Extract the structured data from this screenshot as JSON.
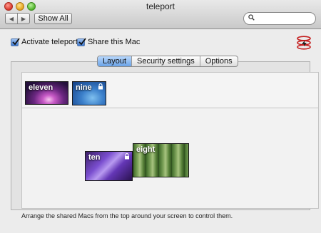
{
  "window": {
    "title": "teleport"
  },
  "toolbar": {
    "back_glyph": "◀",
    "forward_glyph": "▶",
    "show_all_label": "Show All",
    "search_placeholder": ""
  },
  "options": {
    "activate_label": "Activate teleport",
    "activate_checked": true,
    "share_label": "Share this Mac",
    "share_checked": true
  },
  "tabs": [
    {
      "label": "Layout",
      "selected": true
    },
    {
      "label": "Security settings",
      "selected": false
    },
    {
      "label": "Options",
      "selected": false
    }
  ],
  "shelf_macs": [
    {
      "name": "eleven",
      "locked": false
    },
    {
      "name": "nine",
      "locked": true
    }
  ],
  "layout_macs": [
    {
      "name": "ten",
      "locked": true
    },
    {
      "name": "eight",
      "locked": false
    }
  ],
  "footer": {
    "hint": "Arrange the shared Macs from the top around your screen to control them."
  },
  "colors": {
    "tab_active": "#6aa3e8",
    "checkbox": "#3f7ad1",
    "close": "#d9362a",
    "minimize": "#e3a21b",
    "zoom": "#4fb32a"
  },
  "icons": {
    "app": "teleport-app-icon",
    "search": "search-icon",
    "lock": "lock-icon"
  }
}
